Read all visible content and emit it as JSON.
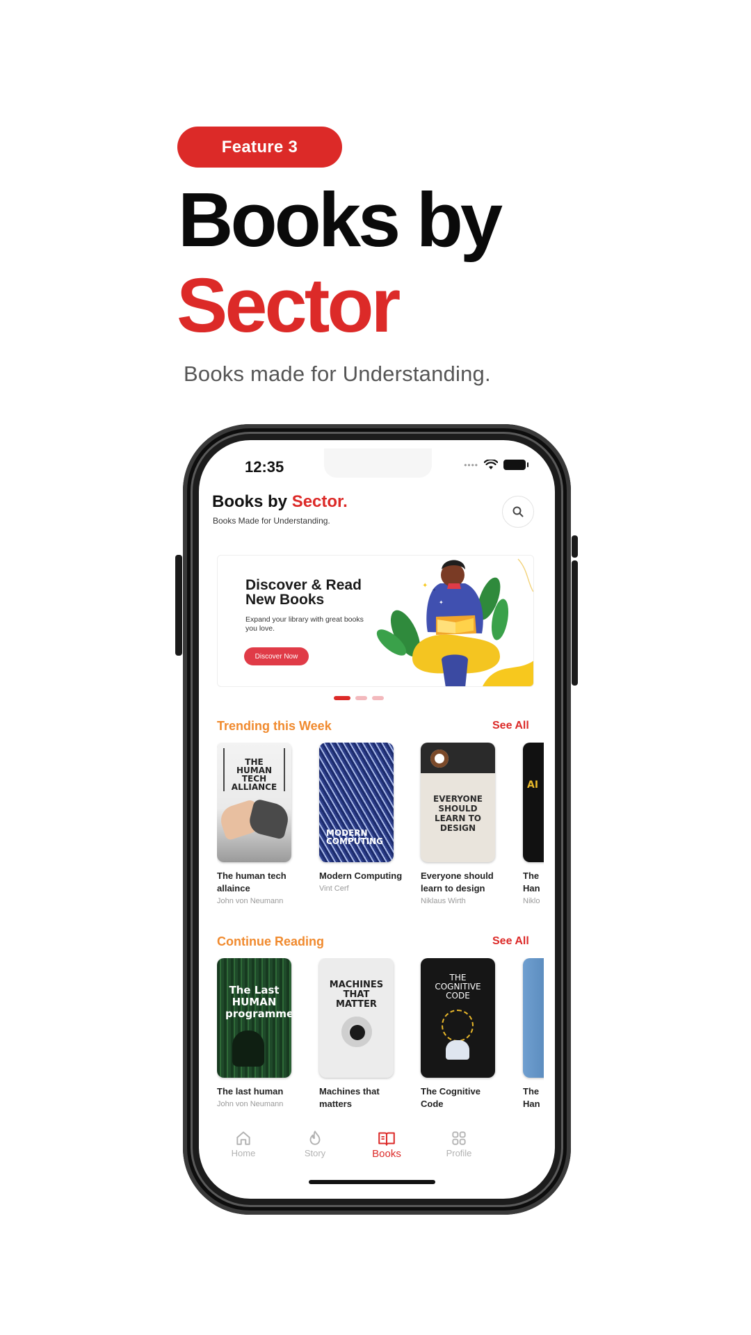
{
  "hero": {
    "feature_label": "Feature 3",
    "title_line1": "Books by",
    "title_line2": "Sector",
    "subtitle": "Books made for Understanding."
  },
  "status": {
    "time": "12:35"
  },
  "app": {
    "title_part1": "Books by ",
    "title_accent": "Sector.",
    "subtitle": "Books Made for Understanding."
  },
  "banner": {
    "title": "Discover & Read New Books",
    "text": "Expand your library with great books you love.",
    "button": "Discover Now"
  },
  "carousel": {
    "count": 3,
    "active_index": 0
  },
  "trending": {
    "title": "Trending this Week",
    "see_all": "See All",
    "books": [
      {
        "title": "The human tech",
        "title2": "allaince",
        "author": "John von Neumann",
        "cover_text": "THE HUMAN TECH ALLIANCE"
      },
      {
        "title": "Modern Computing",
        "title2": "",
        "author": "Vint Cerf",
        "cover_text": "MODERN COMPUTING"
      },
      {
        "title": "Everyone should",
        "title2": "learn to design",
        "author": "Niklaus Wirth",
        "cover_text": "EVERYONE SHOULD LEARN TO DESIGN"
      },
      {
        "title": "The",
        "title2": "Han",
        "author": "Niklo",
        "cover_text": "AI"
      }
    ]
  },
  "continue": {
    "title": "Continue Reading",
    "see_all": "See All",
    "books": [
      {
        "title": "The last human",
        "title2": "",
        "author": "John von Neumann",
        "cover_text": "The Last HUMAN programmer"
      },
      {
        "title": "Machines that",
        "title2": "matters",
        "author": "",
        "cover_text": "MACHINES THAT MATTER"
      },
      {
        "title": "The Cognitive",
        "title2": "Code",
        "author": "",
        "cover_text": "THE COGNITIVE CODE"
      },
      {
        "title": "The",
        "title2": "Han",
        "author": "",
        "cover_text": ""
      }
    ]
  },
  "tabs": [
    {
      "label": "Home",
      "icon": "home-icon"
    },
    {
      "label": "Story",
      "icon": "flame-icon"
    },
    {
      "label": "Books",
      "icon": "book-icon",
      "active": true
    },
    {
      "label": "Profile",
      "icon": "grid-icon"
    }
  ],
  "colors": {
    "brand_red": "#dc2a28",
    "section_orange": "#f08a2e",
    "inactive_tab": "#b2b2b2"
  }
}
